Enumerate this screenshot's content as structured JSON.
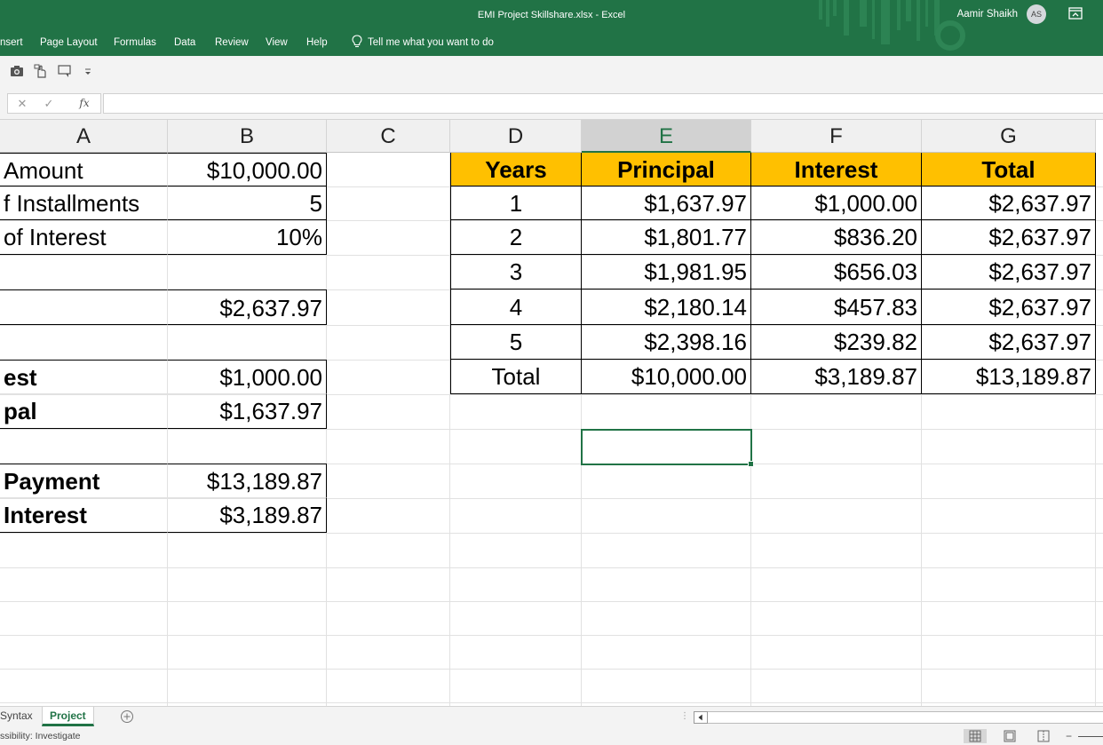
{
  "window": {
    "title": "EMI Project Skillshare.xlsx  -  Excel",
    "user_name": "Aamir Shaikh",
    "user_initials": "AS",
    "brand_color": "#217346"
  },
  "menu": {
    "items": [
      "nsert",
      "Page Layout",
      "Formulas",
      "Data",
      "Review",
      "View",
      "Help"
    ],
    "tell_me": "Tell me what you want to do"
  },
  "formula_bar": {
    "cancel": "✕",
    "enter": "✓",
    "fx": "fx",
    "content": ""
  },
  "columns": [
    "A",
    "B",
    "C",
    "D",
    "E",
    "F",
    "G"
  ],
  "selected_column": "E",
  "left_table": {
    "rows": [
      {
        "label": "Amount",
        "value": "$10,000.00",
        "bold": false
      },
      {
        "label": "f Installments",
        "value": "5",
        "bold": false
      },
      {
        "label": "of Interest",
        "value": "10%",
        "bold": false
      },
      {
        "label": "",
        "value": "",
        "bold": false
      },
      {
        "label": "",
        "value": "$2,637.97",
        "bold": false
      },
      {
        "label": "",
        "value": "",
        "bold": false
      },
      {
        "label": "est",
        "value": "$1,000.00",
        "bold": true
      },
      {
        "label": "pal",
        "value": "$1,637.97",
        "bold": true
      },
      {
        "label": "",
        "value": "",
        "bold": false
      },
      {
        "label": " Payment",
        "value": "$13,189.87",
        "bold": true
      },
      {
        "label": " Interest",
        "value": "$3,189.87",
        "bold": true
      }
    ]
  },
  "schedule": {
    "header_color": "#ffc000",
    "headers": [
      "Years",
      "Principal",
      "Interest",
      "Total"
    ],
    "rows": [
      [
        "1",
        "$1,637.97",
        "$1,000.00",
        "$2,637.97"
      ],
      [
        "2",
        "$1,801.77",
        "$836.20",
        "$2,637.97"
      ],
      [
        "3",
        "$1,981.95",
        "$656.03",
        "$2,637.97"
      ],
      [
        "4",
        "$2,180.14",
        "$457.83",
        "$2,637.97"
      ],
      [
        "5",
        "$2,398.16",
        "$239.82",
        "$2,637.97"
      ],
      [
        "Total",
        "$10,000.00",
        "$3,189.87",
        "$13,189.87"
      ]
    ]
  },
  "sheets": {
    "tabs": [
      "Syntax",
      "Project"
    ],
    "active": "Project"
  },
  "status": {
    "accessibility": "ssibility: Investigate"
  }
}
